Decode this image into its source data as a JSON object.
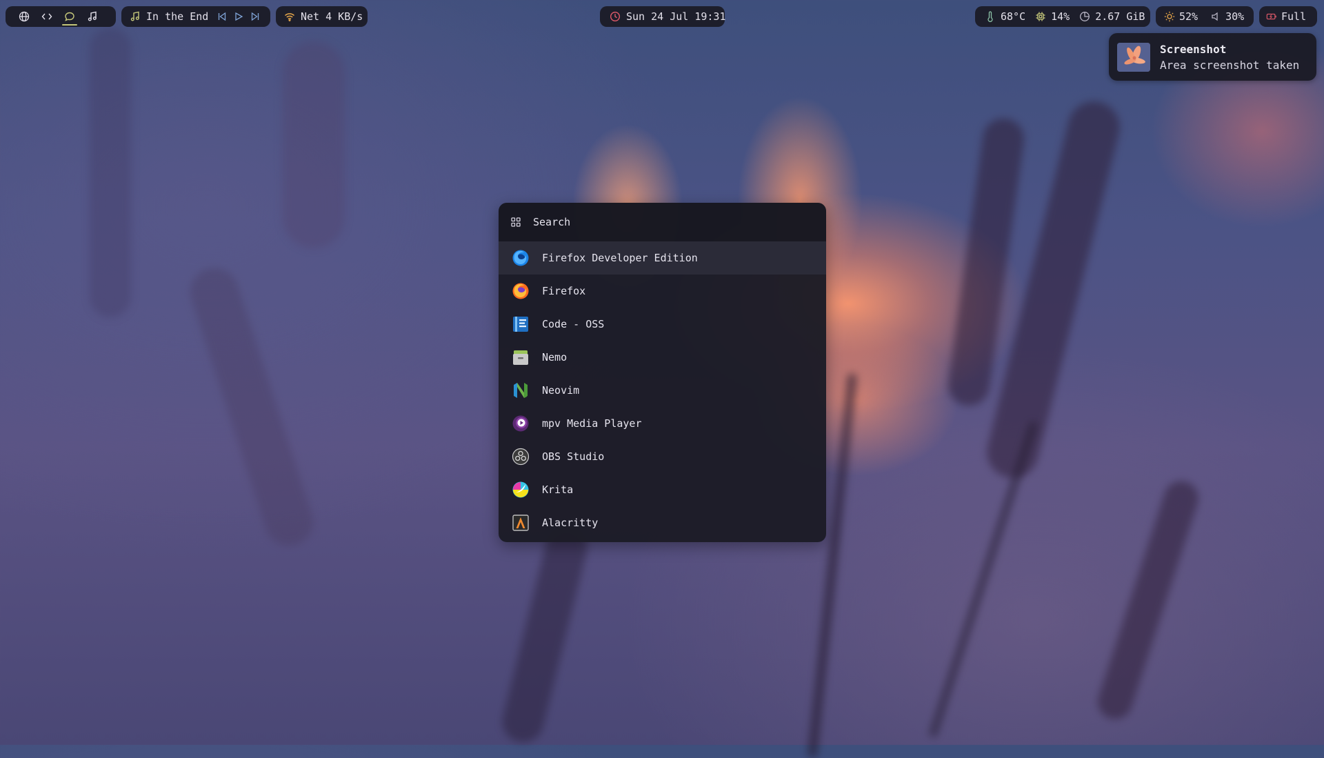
{
  "colors": {
    "bar_bg": "#1a1a24",
    "accent": "#c5c77a",
    "clock_icon": "#e05a6a",
    "battery_icon": "#e05a6a",
    "launcher_bg": "#1c1c26",
    "selected_row": "#2b2b38"
  },
  "topbar": {
    "workspaces": [
      {
        "icon": "globe-icon"
      },
      {
        "icon": "code-icon"
      },
      {
        "icon": "chat-icon",
        "active": true
      },
      {
        "icon": "music-note-icon"
      }
    ],
    "media": {
      "icon": "music-note-icon",
      "title": "In the End",
      "controls": [
        "previous-icon",
        "play-icon",
        "next-icon"
      ]
    },
    "network": {
      "icon": "wifi-icon",
      "text": "Net 4 KB/s"
    },
    "clock": {
      "icon": "clock-icon",
      "text": "Sun 24 Jul 19:31"
    },
    "system": {
      "temperature": {
        "icon": "thermometer-icon",
        "text": "68°C"
      },
      "cpu": {
        "icon": "cpu-icon",
        "text": "14%"
      },
      "memory": {
        "icon": "memory-icon",
        "text": "2.67 GiB"
      }
    },
    "controls": {
      "brightness": {
        "icon": "brightness-icon",
        "text": "52%"
      },
      "volume": {
        "icon": "volume-icon",
        "text": "30%"
      }
    },
    "battery": {
      "icon": "battery-icon",
      "text": "Full"
    }
  },
  "notification": {
    "title": "Screenshot",
    "body": "Area screenshot taken"
  },
  "launcher": {
    "search_placeholder": "Search",
    "search_icon": "grid-icon",
    "selected_index": 0,
    "items": [
      {
        "label": "Firefox Developer Edition",
        "icon": "firefox-developer-icon"
      },
      {
        "label": "Firefox",
        "icon": "firefox-icon"
      },
      {
        "label": "Code - OSS",
        "icon": "code-oss-icon"
      },
      {
        "label": "Nemo",
        "icon": "nemo-icon"
      },
      {
        "label": "Neovim",
        "icon": "neovim-icon"
      },
      {
        "label": "mpv Media Player",
        "icon": "mpv-icon"
      },
      {
        "label": "OBS Studio",
        "icon": "obs-icon"
      },
      {
        "label": "Krita",
        "icon": "krita-icon"
      },
      {
        "label": "Alacritty",
        "icon": "alacritty-icon"
      }
    ]
  }
}
